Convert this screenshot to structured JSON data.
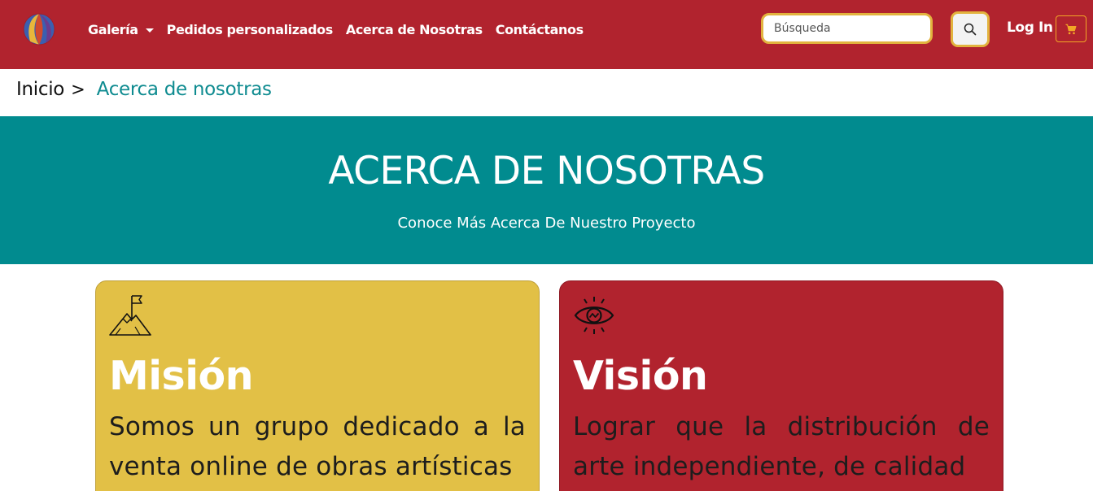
{
  "navbar": {
    "logo_icon": "beach-ball-logo",
    "links": [
      {
        "label": "Galería",
        "dropdown": true
      },
      {
        "label": "Pedidos personalizados"
      },
      {
        "label": "Acerca de Nosotras"
      },
      {
        "label": "Contáctanos"
      }
    ],
    "search": {
      "placeholder": "Búsqueda",
      "value": "",
      "button_icon": "search-icon"
    },
    "login_label": "Log In",
    "cart_icon": "cart-icon"
  },
  "breadcrumb": {
    "home": "Inicio",
    "separator": ">",
    "current": "Acerca de nosotras"
  },
  "hero": {
    "title": "ACERCA DE NOSOTRAS",
    "subtitle": "Conoce Más Acerca De Nuestro Proyecto"
  },
  "cards": {
    "mision": {
      "icon": "mountain-flag-icon",
      "title": "Misión",
      "text": "Somos un grupo dedicado a la venta online de obras artísticas"
    },
    "vision": {
      "icon": "eye-icon",
      "title": "Visión",
      "text": "Lograr que la distribución de arte independiente, de calidad"
    }
  },
  "colors": {
    "navbar": "#b1232e",
    "accent_yellow": "#e2b33e",
    "hero_teal": "#018b8f",
    "breadcrumb_current": "#0e8b90",
    "mision_card": "#e2c046",
    "vision_card": "#b1232e",
    "cart_icon": "#f2a626"
  }
}
